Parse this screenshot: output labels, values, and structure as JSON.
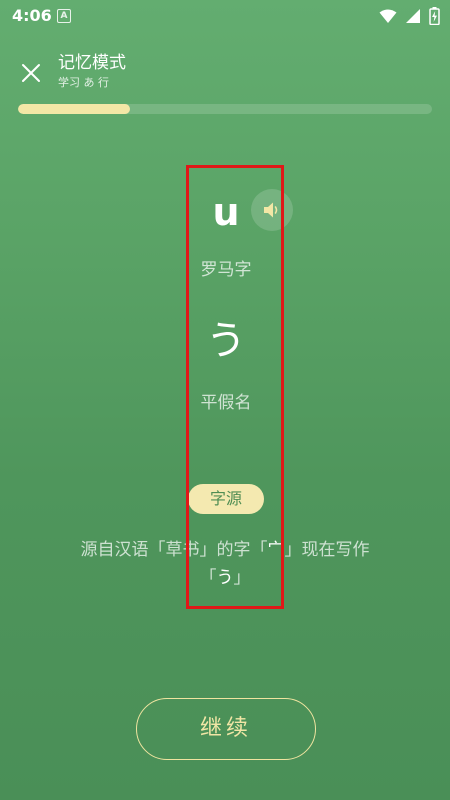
{
  "status_bar": {
    "time": "4:06",
    "app_icon_letter": "A",
    "icons": [
      "wifi-icon",
      "cell-signal-icon",
      "battery-icon"
    ]
  },
  "header": {
    "close_icon": "close-icon",
    "title": "记忆模式",
    "subtitle": "学习 あ 行"
  },
  "progress": {
    "fraction": 0.27
  },
  "card": {
    "romaji": "u",
    "speaker_icon": "speaker-icon",
    "romaji_label": "罗马字",
    "kana": "う",
    "kana_label": "平假名"
  },
  "origin": {
    "badge": "字源",
    "line1_before": "源自汉语「草书」的字「",
    "line1_glyph": "宀",
    "line1_after": "」现在写作",
    "line2_open": "「",
    "line2_glyph": "う",
    "line2_close": "」"
  },
  "actions": {
    "continue_label": "继续"
  },
  "colors": {
    "background": "#5aa366",
    "accent": "#f4e9b0",
    "highlight": "#e01818"
  }
}
